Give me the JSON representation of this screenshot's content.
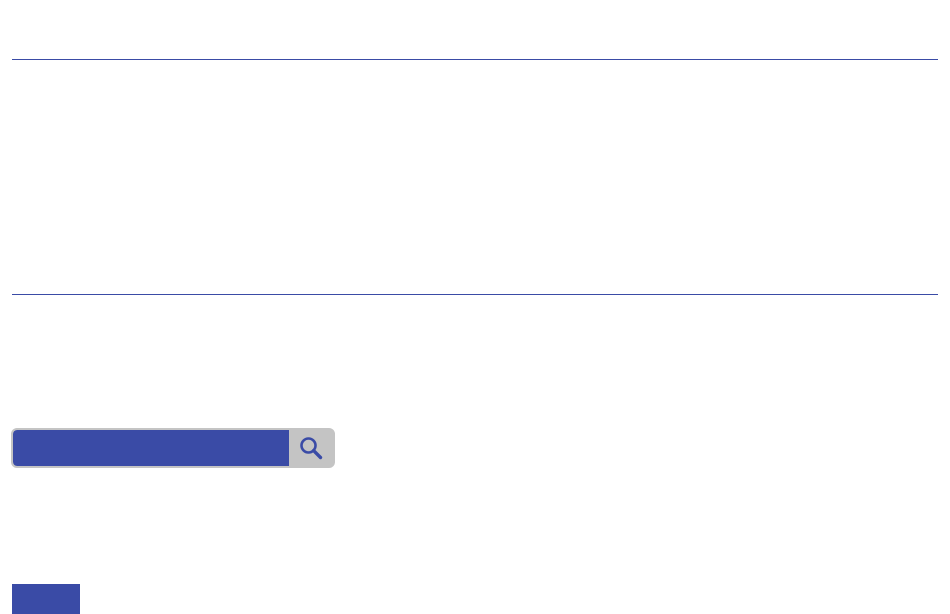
{
  "colors": {
    "accent": "#3a4ba6",
    "search_button_bg": "#c4c4c4",
    "background": "#ffffff"
  },
  "search": {
    "value": "",
    "placeholder": "",
    "button_icon": "search-icon"
  },
  "bottom_button": {
    "label": ""
  }
}
